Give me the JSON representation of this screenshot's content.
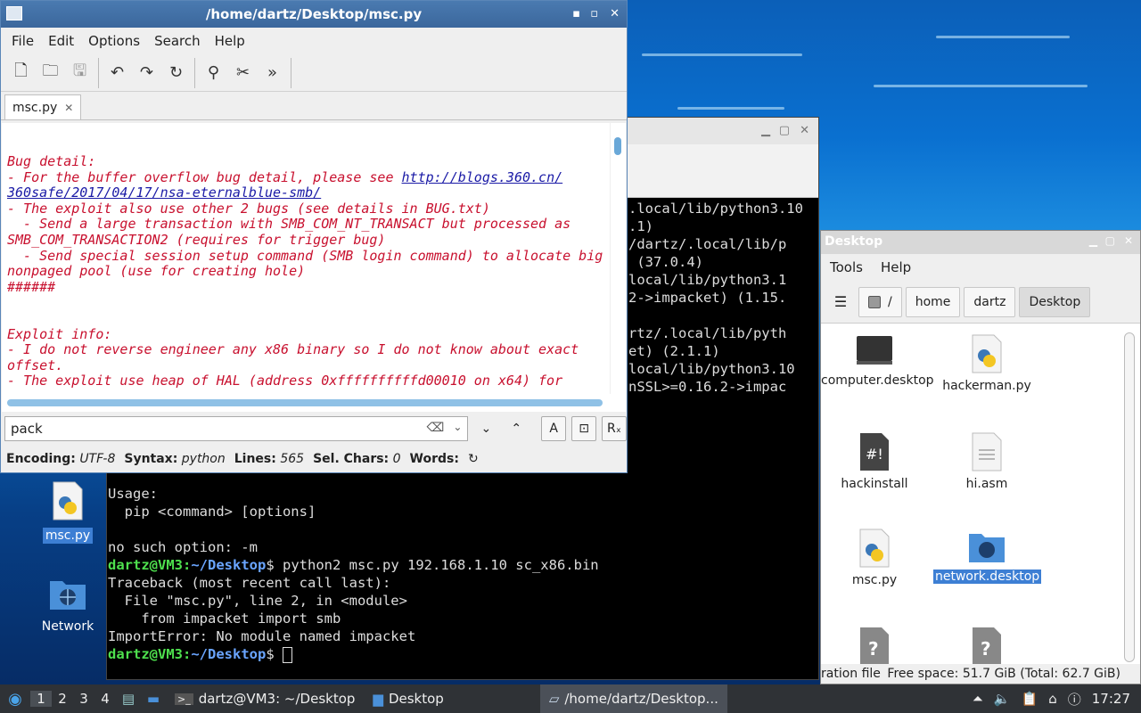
{
  "editor": {
    "title": "/home/dartz/Desktop/msc.py",
    "menu": [
      "File",
      "Edit",
      "Options",
      "Search",
      "Help"
    ],
    "tab": "msc.py",
    "link": "http://blogs.360.cn/",
    "lines": [
      "Bug detail:",
      "- For the buffer overflow bug detail, please see ",
      "360safe/2017/04/17/nsa-eternalblue-smb/",
      "- The exploit also use other 2 bugs (see details in BUG.txt)",
      "  - Send a large transaction with SMB_COM_NT_TRANSACT but processed as",
      "SMB_COM_TRANSACTION2 (requires for trigger bug)",
      "  - Send special session setup command (SMB login command) to allocate big",
      "nonpaged pool (use for creating hole)",
      "######",
      "",
      "",
      "Exploit info:",
      "- I do not reverse engineer any x86 binary so I do not know about exact",
      "offset.",
      "- The exploit use heap of HAL (address 0xffffffffffd00010 on x64) for"
    ],
    "find_value": "pack",
    "status": {
      "encoding_label": "Encoding:",
      "encoding": "UTF-8",
      "syntax_label": "Syntax:",
      "syntax": "python",
      "lines_label": "Lines:",
      "lines": "565",
      "sel_label": "Sel. Chars:",
      "sel": "0",
      "words_label": "Words:"
    }
  },
  "terminal": {
    "right_lines": [
      ".local/lib/python3.10",
      ".1)",
      "/dartz/.local/lib/p",
      " (37.0.4)",
      "local/lib/python3.1",
      "2->impacket) (1.15.",
      "",
      "rtz/.local/lib/pyth",
      "et) (2.1.1)",
      "local/lib/python3.10",
      "nSSL>=0.16.2->impac"
    ],
    "usage": "Usage:",
    "pip_line": "  pip <command> [options]",
    "blank": "",
    "nosuch": "no such option: -m",
    "prompt_user": "dartz@VM3",
    "prompt_path": "~/Desktop",
    "prompt_sign": "$ ",
    "command": "python2 msc.py 192.168.1.10 sc_x86.bin",
    "traceback": [
      "Traceback (most recent call last):",
      "  File \"msc.py\", line 2, in <module>",
      "    from impacket import smb",
      "ImportError: No module named impacket"
    ]
  },
  "filemanager": {
    "title": "Desktop",
    "menu": [
      "Tools",
      "Help"
    ],
    "crumbs": [
      "/",
      "home",
      "dartz",
      "Desktop"
    ],
    "items": [
      "computer.desktop",
      "hackerman.py",
      "hackinstall",
      "hi.asm",
      "msc.py",
      "network.desktop"
    ],
    "status_left": "ration file",
    "status_right": "Free space: 51.7 GiB (Total: 62.7 GiB)"
  },
  "desktop": {
    "icons": [
      "msc.py",
      "Network"
    ]
  },
  "taskbar": {
    "workspaces": [
      "1",
      "2",
      "3",
      "4"
    ],
    "tasks": [
      "dartz@VM3: ~/Desktop",
      "Desktop",
      "/home/dartz/Desktop..."
    ],
    "clock": "17:27"
  },
  "colors": {
    "editor_text": "#c8102e",
    "selection": "#3d7fd4",
    "prompt_green": "#4ee04e",
    "prompt_blue": "#6aa5ff"
  }
}
